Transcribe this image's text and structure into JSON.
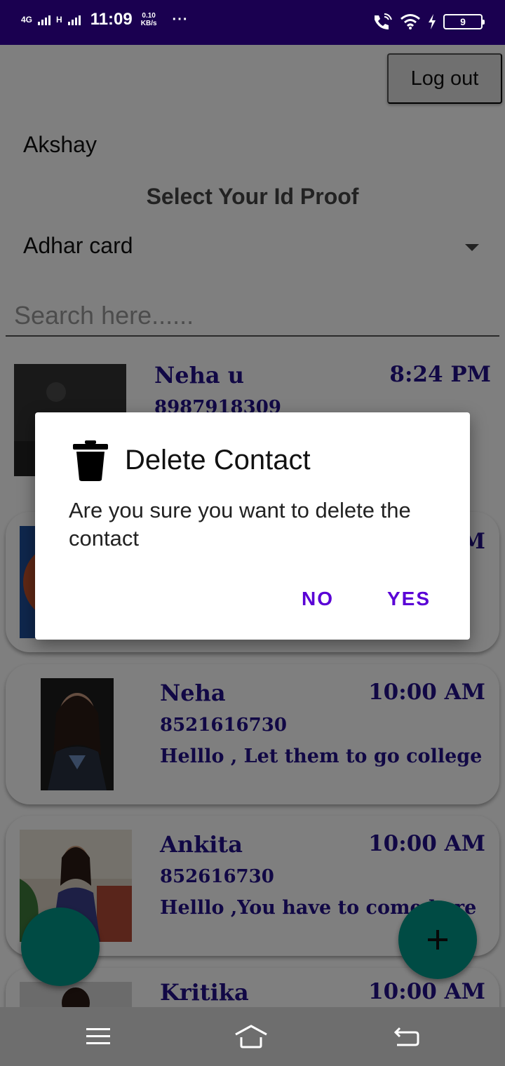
{
  "status_bar": {
    "network_type": "4G",
    "network_type2": "H",
    "time": "11:09",
    "speed_value": "0.10",
    "speed_unit": "KB/s",
    "more": "···",
    "battery": "9"
  },
  "header": {
    "logout_label": "Log out",
    "username": "Akshay"
  },
  "id_proof": {
    "title": "Select Your Id Proof",
    "selected": "Adhar card"
  },
  "search": {
    "placeholder": "Search here......"
  },
  "contacts": [
    {
      "name": "Neha u",
      "time": "8:24 PM",
      "phone": "8987918309",
      "message": ""
    },
    {
      "name": "",
      "time": "M",
      "phone": "",
      "message": ""
    },
    {
      "name": "Neha",
      "time": "10:00 AM",
      "phone": "8521616730",
      "message": "Helllo , Let them to go college"
    },
    {
      "name": "Ankita",
      "time": "10:00 AM",
      "phone": "852616730",
      "message": "Helllo ,You have to come here"
    },
    {
      "name": "Kritika",
      "time": "10:00 AM",
      "phone": "",
      "message": ""
    }
  ],
  "fab": {
    "add_icon": "plus-icon"
  },
  "dialog": {
    "title": "Delete Contact",
    "message": "Are you sure you want to delete the contact",
    "no_label": "NO",
    "yes_label": "YES",
    "icon": "trash-icon"
  },
  "colors": {
    "status_bar": "#1a0050",
    "accent": "#5a00d6",
    "contact_text": "#23108a",
    "fab": "#009688"
  }
}
